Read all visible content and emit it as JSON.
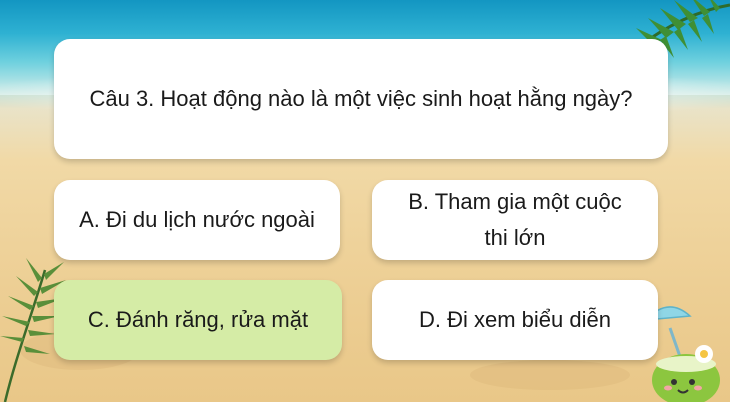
{
  "question": {
    "text": "Câu 3. Hoạt động nào là một việc sinh hoạt hằng ngày?"
  },
  "answers": [
    {
      "label": "A. Đi du lịch nước ngoài"
    },
    {
      "label": "B. Tham gia một cuộc thi lớn"
    },
    {
      "label": "C. Đánh răng, rửa mặt",
      "highlighted": true
    },
    {
      "label": "D. Đi xem biểu diễn"
    }
  ],
  "colors": {
    "card": "#ffffff",
    "highlight": "#d5eca6",
    "sea": "#1fa3c9",
    "sand": "#edcf95"
  },
  "decorations": [
    "palm-leaf-top-right",
    "palm-leaf-bottom-left",
    "coconut-drink-icon"
  ]
}
